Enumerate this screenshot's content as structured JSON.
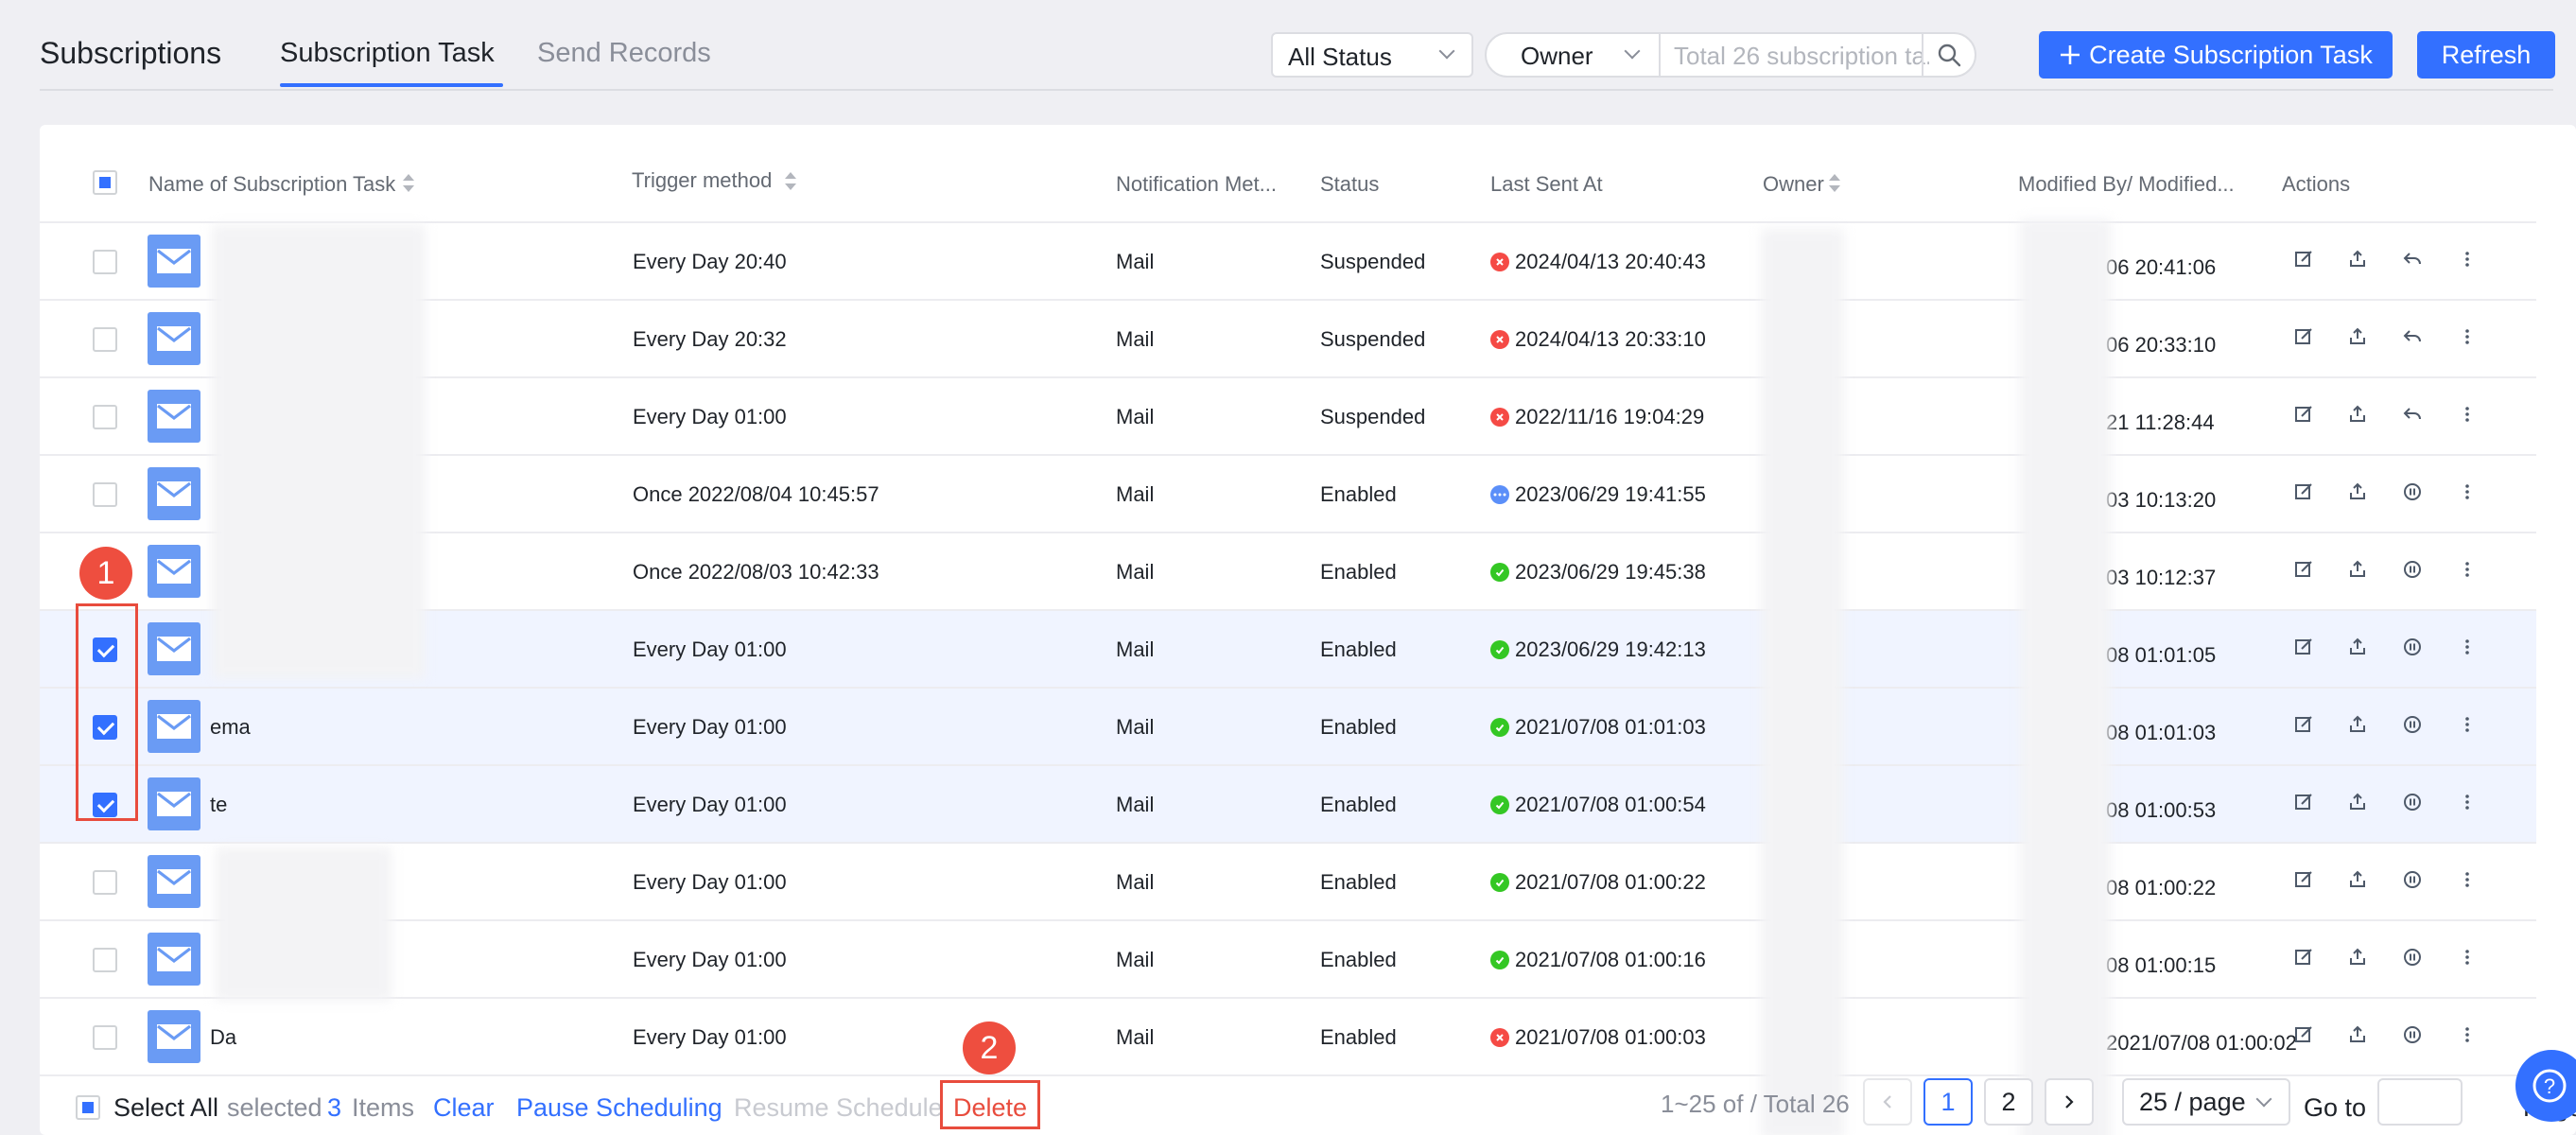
{
  "header": {
    "title": "Subscriptions",
    "tabs": [
      {
        "label": "Subscription Task",
        "active": true
      },
      {
        "label": "Send Records",
        "active": false
      }
    ],
    "status_filter": "All Status",
    "owner_filter": "Owner",
    "search_placeholder": "Total 26 subscription ta...",
    "create_label": "Create Subscription Task",
    "refresh_label": "Refresh"
  },
  "table": {
    "columns": [
      "Name of Subscription Task",
      "Trigger method",
      "Notification Met...",
      "Status",
      "Last Sent At",
      "Owner",
      "Modified By/ Modified...",
      "Actions"
    ],
    "rows": [
      {
        "name": "",
        "trigger": "Every Day 20:40",
        "notification": "Mail",
        "status": "Suspended",
        "last_sent": "2024/04/13 20:40:43",
        "sent_state": "error",
        "modified": "06 20:41:06",
        "selected": false,
        "action3": "reply-icon"
      },
      {
        "name": "",
        "trigger": "Every Day 20:32",
        "notification": "Mail",
        "status": "Suspended",
        "last_sent": "2024/04/13 20:33:10",
        "sent_state": "error",
        "modified": "06 20:33:10",
        "selected": false,
        "action3": "reply-icon"
      },
      {
        "name": "",
        "trigger": "Every Day 01:00",
        "notification": "Mail",
        "status": "Suspended",
        "last_sent": "2022/11/16 19:04:29",
        "sent_state": "error",
        "modified": "21 11:28:44",
        "selected": false,
        "action3": "reply-icon"
      },
      {
        "name": "",
        "trigger": "Once 2022/08/04 10:45:57",
        "notification": "Mail",
        "status": "Enabled",
        "last_sent": "2023/06/29 19:41:55",
        "sent_state": "running",
        "modified": "03 10:13:20",
        "selected": false,
        "action3": "pause-icon"
      },
      {
        "name": "",
        "trigger": "Once 2022/08/03 10:42:33",
        "notification": "Mail",
        "status": "Enabled",
        "last_sent": "2023/06/29 19:45:38",
        "sent_state": "success",
        "modified": "03 10:12:37",
        "selected": false,
        "action3": "pause-icon"
      },
      {
        "name": "",
        "trigger": "Every Day 01:00",
        "notification": "Mail",
        "status": "Enabled",
        "last_sent": "2023/06/29 19:42:13",
        "sent_state": "success",
        "modified": "08 01:01:05",
        "selected": true,
        "action3": "pause-icon"
      },
      {
        "name": "ema",
        "trigger": "Every Day 01:00",
        "notification": "Mail",
        "status": "Enabled",
        "last_sent": "2021/07/08 01:01:03",
        "sent_state": "success",
        "modified": "08 01:01:03",
        "selected": true,
        "action3": "pause-icon"
      },
      {
        "name": "te",
        "trigger": "Every Day 01:00",
        "notification": "Mail",
        "status": "Enabled",
        "last_sent": "2021/07/08 01:00:54",
        "sent_state": "success",
        "modified": "08 01:00:53",
        "selected": true,
        "action3": "pause-icon"
      },
      {
        "name": "",
        "trigger": "Every Day 01:00",
        "notification": "Mail",
        "status": "Enabled",
        "last_sent": "2021/07/08 01:00:22",
        "sent_state": "success",
        "modified": "08 01:00:22",
        "selected": false,
        "action3": "pause-icon"
      },
      {
        "name": "",
        "trigger": "Every Day 01:00",
        "notification": "Mail",
        "status": "Enabled",
        "last_sent": "2021/07/08 01:00:16",
        "sent_state": "success",
        "modified": "08 01:00:15",
        "selected": false,
        "action3": "pause-icon"
      },
      {
        "name": "Da",
        "trigger": "Every Day 01:00",
        "notification": "Mail",
        "status": "Enabled",
        "last_sent": "2021/07/08 01:00:03",
        "sent_state": "error",
        "modified": "2021/07/08 01:00:02",
        "selected": false,
        "action3": "pause-icon"
      }
    ]
  },
  "annotations": [
    "1",
    "2"
  ],
  "footer": {
    "select_all": "Select All",
    "selected_prefix": "selected",
    "selected_count": "3",
    "items_label": "Items",
    "clear": "Clear",
    "pause": "Pause Scheduling",
    "resume": "Resume Schedule",
    "delete": "Delete",
    "range": "1~25 of / Total 26",
    "pages": [
      "1",
      "2"
    ],
    "current_page": "1",
    "page_size": "25 / page",
    "goto": "Go to",
    "page_label": "Page"
  },
  "colors": {
    "accent": "#3370ff",
    "annotation": "#e84c3d",
    "error": "#f54a45",
    "success": "#34c724",
    "running": "#5b8ff9",
    "selected_row": "#f0f4ff"
  }
}
